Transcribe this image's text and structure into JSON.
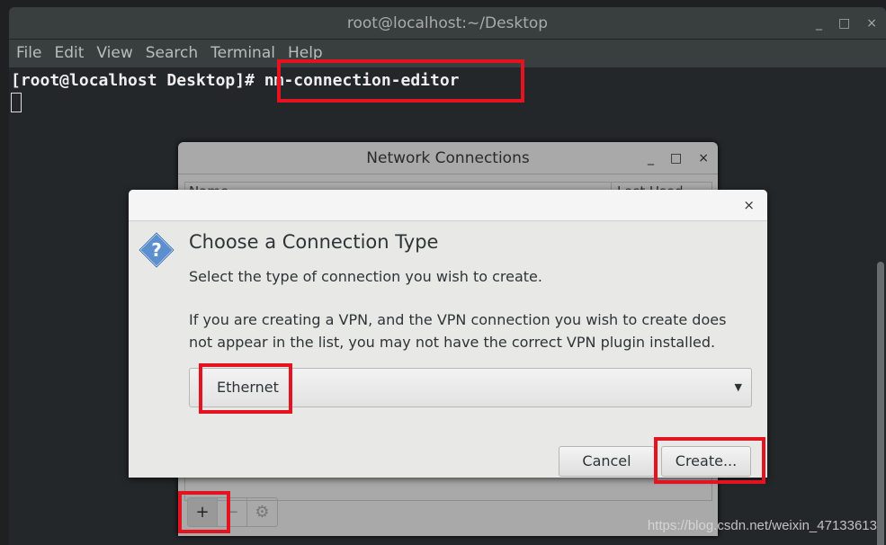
{
  "terminal": {
    "title": "root@localhost:~/Desktop",
    "controls": [
      "_",
      "□",
      "×"
    ],
    "menu": [
      "File",
      "Edit",
      "View",
      "Search",
      "Terminal",
      "Help"
    ],
    "prompt": "[root@localhost Desktop]#",
    "command": "nm-connection-editor"
  },
  "network_window": {
    "title": "Network Connections",
    "controls": [
      "_",
      "□",
      "×"
    ],
    "columns": [
      "Name",
      "Last Used"
    ],
    "tools": {
      "add": "+",
      "remove": "−",
      "settings": "⚙"
    }
  },
  "dialog": {
    "close": "×",
    "icon": "question-icon",
    "heading": "Choose a Connection Type",
    "text1": "Select the type of connection you wish to create.",
    "text2": "If you are creating a VPN, and the VPN connection you wish to create does not appear in the list, you may not have the correct VPN plugin installed.",
    "selected_type": "Ethernet",
    "cancel": "Cancel",
    "create": "Create..."
  },
  "watermark": "https://blog.csdn.net/weixin_47133613",
  "colors": {
    "highlight": "#e5121f"
  }
}
